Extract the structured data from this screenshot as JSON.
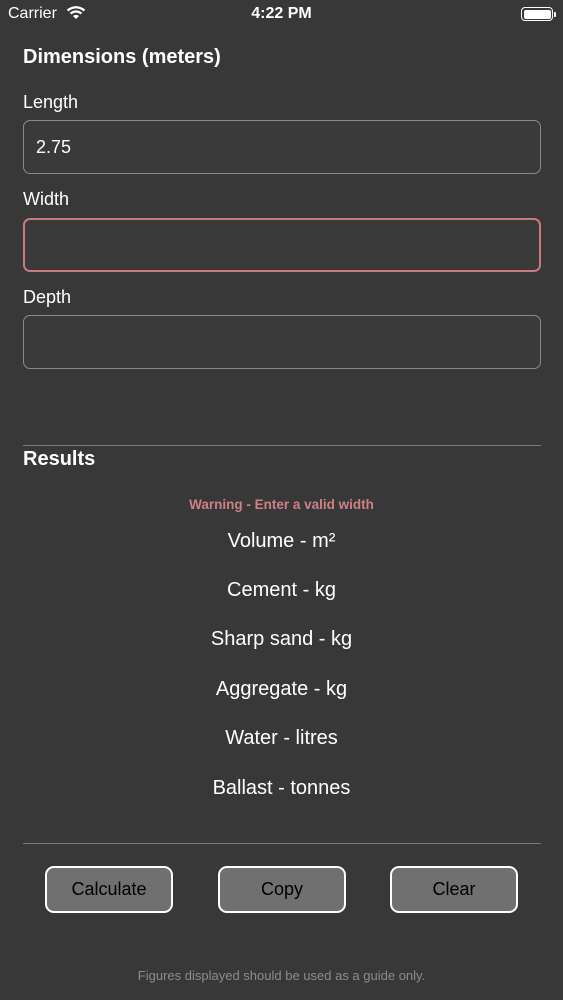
{
  "status_bar": {
    "carrier": "Carrier",
    "time": "4:22 PM"
  },
  "dimensions": {
    "title": "Dimensions (meters)",
    "length": {
      "label": "Length",
      "value": "2.75"
    },
    "width": {
      "label": "Width",
      "value": ""
    },
    "depth": {
      "label": "Depth",
      "value": ""
    }
  },
  "results": {
    "title": "Results",
    "warning": "Warning - Enter a valid width",
    "volume": "Volume -  m²",
    "cement": "Cement -  kg",
    "sharp_sand": "Sharp sand -  kg",
    "aggregate": "Aggregate -  kg",
    "water": "Water -  litres",
    "ballast": "Ballast -  tonnes"
  },
  "buttons": {
    "calculate": "Calculate",
    "copy": "Copy",
    "clear": "Clear"
  },
  "footer": "Figures displayed should be used as a guide only.",
  "colors": {
    "background": "#383838",
    "warning": "#cf7f86",
    "error_border": "#c97a80"
  }
}
